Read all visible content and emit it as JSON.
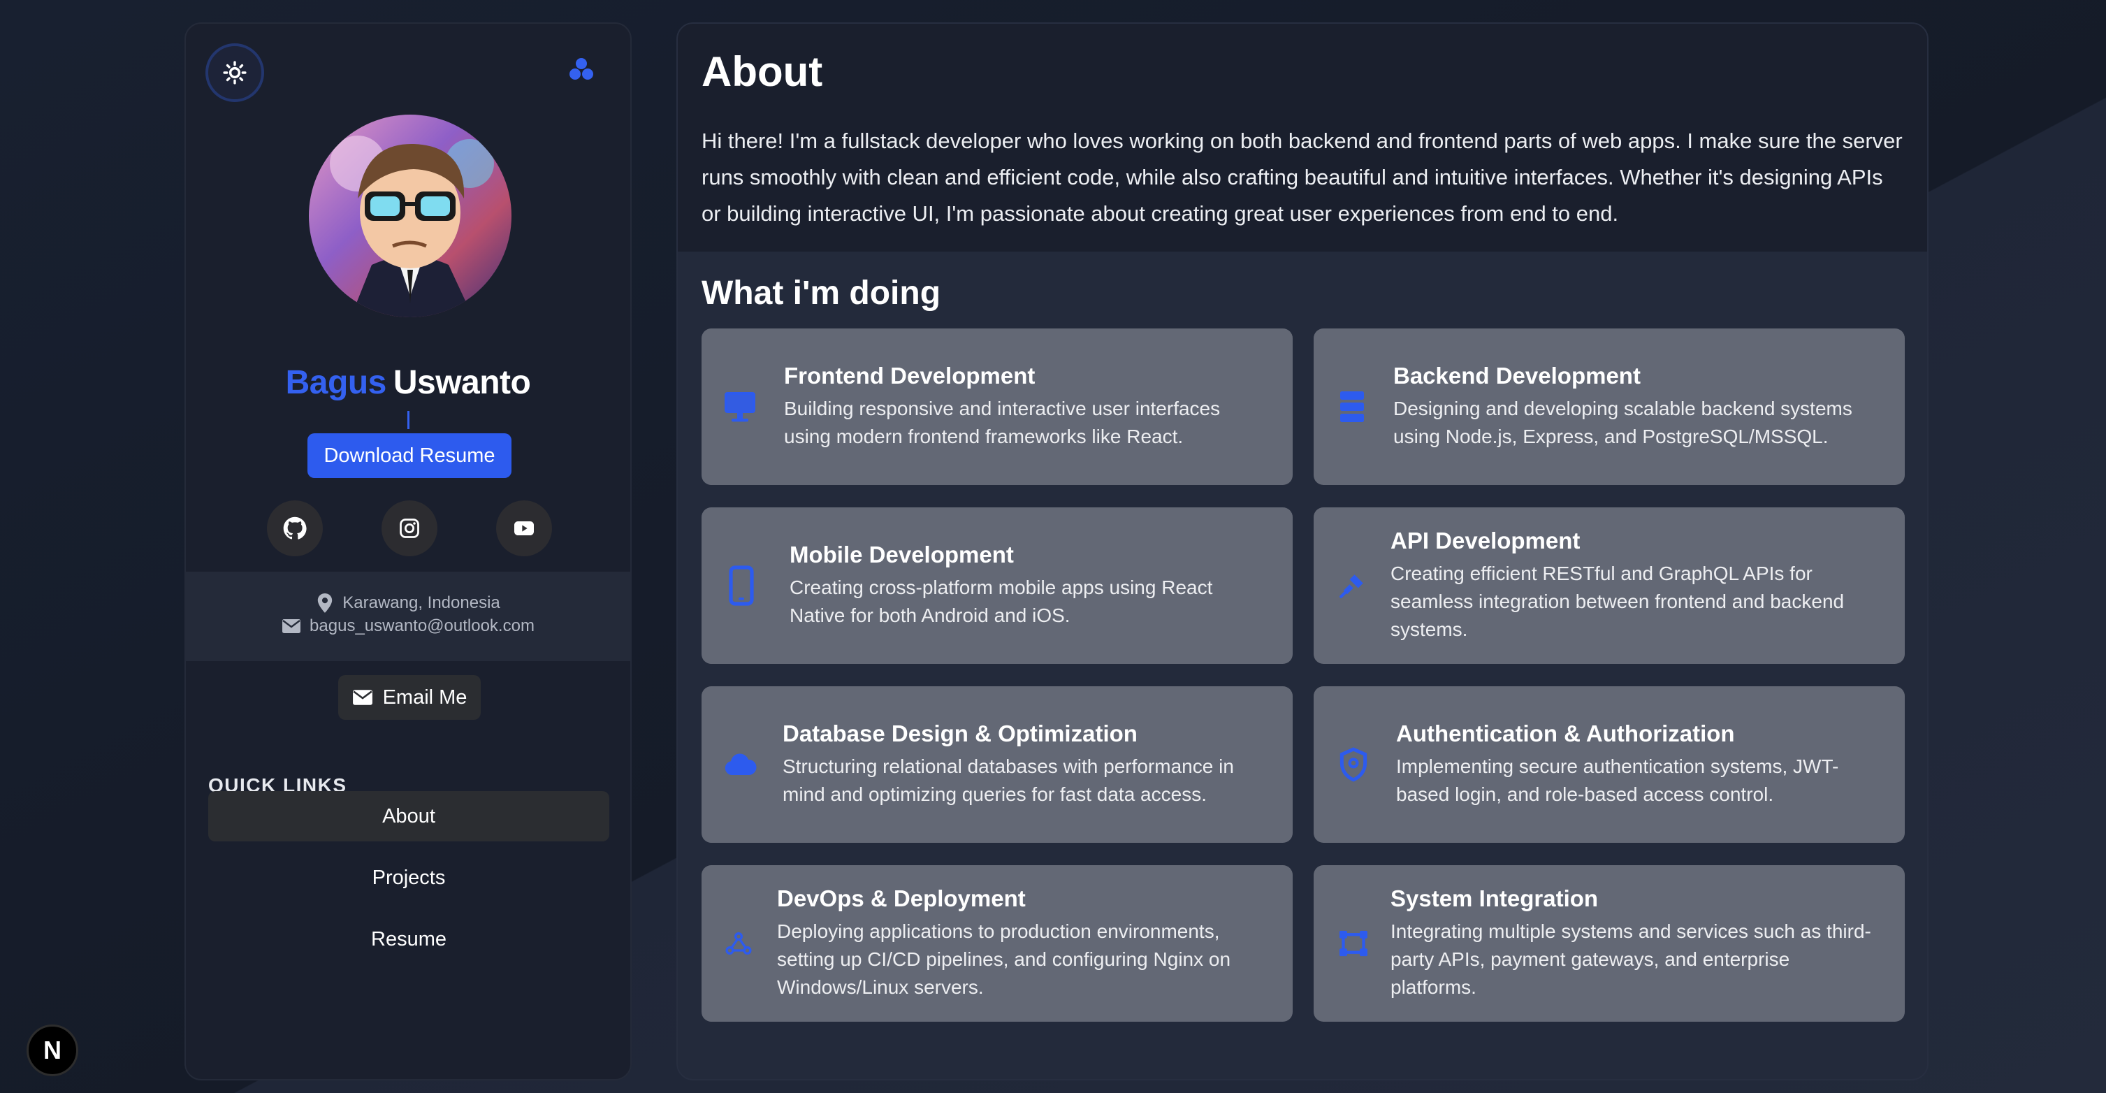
{
  "profile": {
    "first_name": "Bagus",
    "last_name": "Uswanto",
    "download_label": "Download Resume",
    "location": "Karawang, Indonesia",
    "email": "bagus_uswanto@outlook.com",
    "email_button": "Email Me"
  },
  "socials": [
    {
      "icon": "github-icon"
    },
    {
      "icon": "instagram-icon"
    },
    {
      "icon": "youtube-icon"
    }
  ],
  "quick_links": {
    "title": "QUICK LINKS",
    "items": [
      {
        "label": "About",
        "active": true
      },
      {
        "label": "Projects",
        "active": false
      },
      {
        "label": "Resume",
        "active": false
      }
    ]
  },
  "about": {
    "title": "About",
    "text": "Hi there! I'm a fullstack developer who loves working on both backend and frontend parts of web apps. I make sure the server runs smoothly with clean and efficient code, while also crafting beautiful and intuitive interfaces. Whether it's designing APIs or building interactive UI, I'm passionate about creating great user experiences from end to end."
  },
  "doing": {
    "title": "What i'm doing",
    "cards": [
      {
        "title": "Frontend Development",
        "desc": "Building responsive and interactive user interfaces using modern frontend frameworks like React.",
        "icon": "monitor-icon"
      },
      {
        "title": "Backend Development",
        "desc": "Designing and developing scalable backend systems using Node.js, Express, and PostgreSQL/MSSQL.",
        "icon": "server-icon"
      },
      {
        "title": "Mobile Development",
        "desc": "Creating cross-platform mobile apps using React Native for both Android and iOS.",
        "icon": "mobile-icon"
      },
      {
        "title": "API Development",
        "desc": "Creating efficient RESTful and GraphQL APIs for seamless integration between frontend and backend systems.",
        "icon": "plug-icon"
      },
      {
        "title": "Database Design & Optimization",
        "desc": "Structuring relational databases with performance in mind and optimizing queries for fast data access.",
        "icon": "cloud-icon"
      },
      {
        "title": "Authentication & Authorization",
        "desc": "Implementing secure authentication systems, JWT-based login, and role-based access control.",
        "icon": "shield-icon"
      },
      {
        "title": "DevOps & Deployment",
        "desc": "Deploying applications to production environments, setting up CI/CD pipelines, and configuring Nginx on Windows/Linux servers.",
        "icon": "deploy-icon"
      },
      {
        "title": "System Integration",
        "desc": "Integrating multiple systems and services such as third-party APIs, payment gateways, and enterprise platforms.",
        "icon": "integration-icon"
      }
    ]
  },
  "next_badge": "N",
  "colors": {
    "accent": "#2d5bee",
    "card_bg": "#636875",
    "sidebar_bg": "#1a1f2d"
  }
}
